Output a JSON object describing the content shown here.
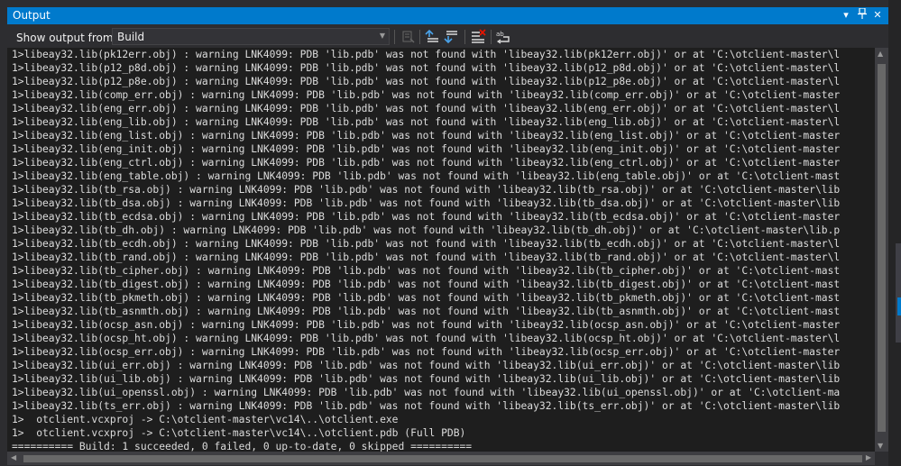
{
  "window": {
    "title": "Output"
  },
  "toolbar": {
    "show_output_label": "Show output from:",
    "source_value": "Build",
    "tools": [
      "go-to-previous-message-icon",
      "go-to-next-message-icon",
      "clear-all-icon",
      "toggle-word-wrap-icon"
    ]
  },
  "output": {
    "lines": [
      "1>libeay32.lib(pk12err.obj) : warning LNK4099: PDB 'lib.pdb' was not found with 'libeay32.lib(pk12err.obj)' or at 'C:\\otclient-master\\l",
      "1>libeay32.lib(p12_p8d.obj) : warning LNK4099: PDB 'lib.pdb' was not found with 'libeay32.lib(p12_p8d.obj)' or at 'C:\\otclient-master\\l",
      "1>libeay32.lib(p12_p8e.obj) : warning LNK4099: PDB 'lib.pdb' was not found with 'libeay32.lib(p12_p8e.obj)' or at 'C:\\otclient-master\\l",
      "1>libeay32.lib(comp_err.obj) : warning LNK4099: PDB 'lib.pdb' was not found with 'libeay32.lib(comp_err.obj)' or at 'C:\\otclient-master",
      "1>libeay32.lib(eng_err.obj) : warning LNK4099: PDB 'lib.pdb' was not found with 'libeay32.lib(eng_err.obj)' or at 'C:\\otclient-master\\l",
      "1>libeay32.lib(eng_lib.obj) : warning LNK4099: PDB 'lib.pdb' was not found with 'libeay32.lib(eng_lib.obj)' or at 'C:\\otclient-master\\l",
      "1>libeay32.lib(eng_list.obj) : warning LNK4099: PDB 'lib.pdb' was not found with 'libeay32.lib(eng_list.obj)' or at 'C:\\otclient-master",
      "1>libeay32.lib(eng_init.obj) : warning LNK4099: PDB 'lib.pdb' was not found with 'libeay32.lib(eng_init.obj)' or at 'C:\\otclient-master",
      "1>libeay32.lib(eng_ctrl.obj) : warning LNK4099: PDB 'lib.pdb' was not found with 'libeay32.lib(eng_ctrl.obj)' or at 'C:\\otclient-master",
      "1>libeay32.lib(eng_table.obj) : warning LNK4099: PDB 'lib.pdb' was not found with 'libeay32.lib(eng_table.obj)' or at 'C:\\otclient-mast",
      "1>libeay32.lib(tb_rsa.obj) : warning LNK4099: PDB 'lib.pdb' was not found with 'libeay32.lib(tb_rsa.obj)' or at 'C:\\otclient-master\\lib",
      "1>libeay32.lib(tb_dsa.obj) : warning LNK4099: PDB 'lib.pdb' was not found with 'libeay32.lib(tb_dsa.obj)' or at 'C:\\otclient-master\\lib",
      "1>libeay32.lib(tb_ecdsa.obj) : warning LNK4099: PDB 'lib.pdb' was not found with 'libeay32.lib(tb_ecdsa.obj)' or at 'C:\\otclient-master",
      "1>libeay32.lib(tb_dh.obj) : warning LNK4099: PDB 'lib.pdb' was not found with 'libeay32.lib(tb_dh.obj)' or at 'C:\\otclient-master\\lib.p",
      "1>libeay32.lib(tb_ecdh.obj) : warning LNK4099: PDB 'lib.pdb' was not found with 'libeay32.lib(tb_ecdh.obj)' or at 'C:\\otclient-master\\l",
      "1>libeay32.lib(tb_rand.obj) : warning LNK4099: PDB 'lib.pdb' was not found with 'libeay32.lib(tb_rand.obj)' or at 'C:\\otclient-master\\l",
      "1>libeay32.lib(tb_cipher.obj) : warning LNK4099: PDB 'lib.pdb' was not found with 'libeay32.lib(tb_cipher.obj)' or at 'C:\\otclient-mast",
      "1>libeay32.lib(tb_digest.obj) : warning LNK4099: PDB 'lib.pdb' was not found with 'libeay32.lib(tb_digest.obj)' or at 'C:\\otclient-mast",
      "1>libeay32.lib(tb_pkmeth.obj) : warning LNK4099: PDB 'lib.pdb' was not found with 'libeay32.lib(tb_pkmeth.obj)' or at 'C:\\otclient-mast",
      "1>libeay32.lib(tb_asnmth.obj) : warning LNK4099: PDB 'lib.pdb' was not found with 'libeay32.lib(tb_asnmth.obj)' or at 'C:\\otclient-mast",
      "1>libeay32.lib(ocsp_asn.obj) : warning LNK4099: PDB 'lib.pdb' was not found with 'libeay32.lib(ocsp_asn.obj)' or at 'C:\\otclient-master",
      "1>libeay32.lib(ocsp_ht.obj) : warning LNK4099: PDB 'lib.pdb' was not found with 'libeay32.lib(ocsp_ht.obj)' or at 'C:\\otclient-master\\l",
      "1>libeay32.lib(ocsp_err.obj) : warning LNK4099: PDB 'lib.pdb' was not found with 'libeay32.lib(ocsp_err.obj)' or at 'C:\\otclient-master",
      "1>libeay32.lib(ui_err.obj) : warning LNK4099: PDB 'lib.pdb' was not found with 'libeay32.lib(ui_err.obj)' or at 'C:\\otclient-master\\lib",
      "1>libeay32.lib(ui_lib.obj) : warning LNK4099: PDB 'lib.pdb' was not found with 'libeay32.lib(ui_lib.obj)' or at 'C:\\otclient-master\\lib",
      "1>libeay32.lib(ui_openssl.obj) : warning LNK4099: PDB 'lib.pdb' was not found with 'libeay32.lib(ui_openssl.obj)' or at 'C:\\otclient-ma",
      "1>libeay32.lib(ts_err.obj) : warning LNK4099: PDB 'lib.pdb' was not found with 'libeay32.lib(ts_err.obj)' or at 'C:\\otclient-master\\lib",
      "1>  otclient.vcxproj -> C:\\otclient-master\\vc14\\..\\otclient.exe",
      "1>  otclient.vcxproj -> C:\\otclient-master\\vc14\\..\\otclient.pdb (Full PDB)",
      "========== Build: 1 succeeded, 0 failed, 0 up-to-date, 0 skipped =========="
    ]
  }
}
